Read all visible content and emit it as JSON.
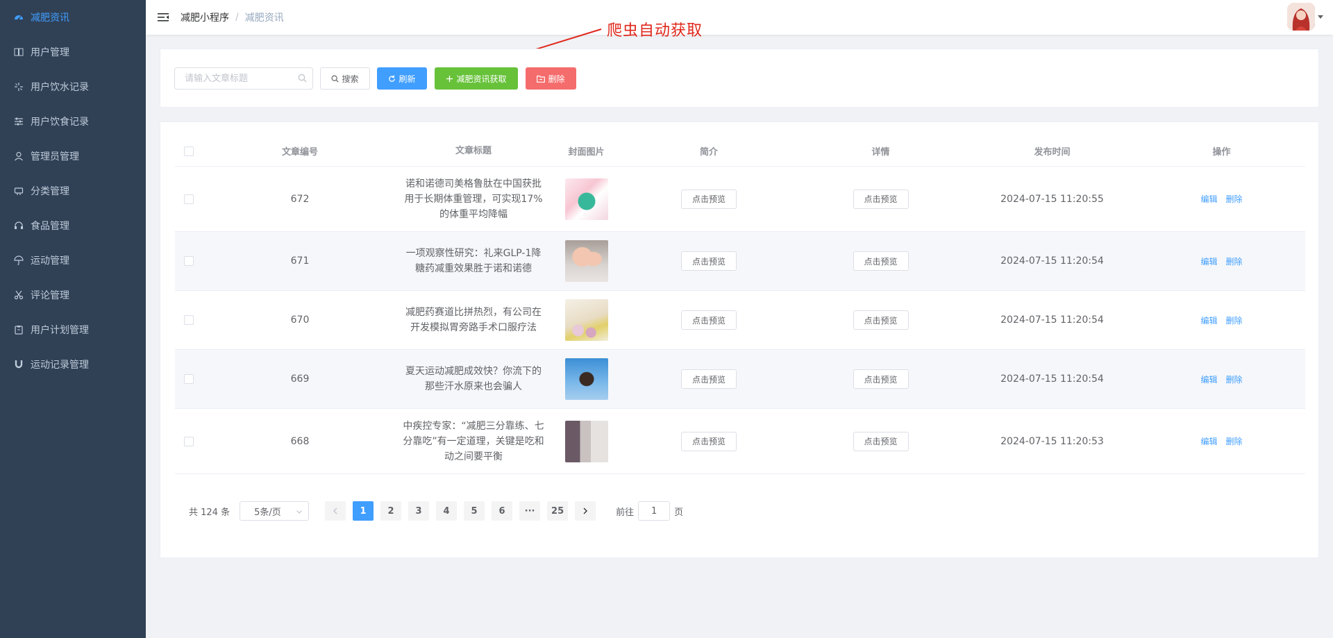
{
  "sidebar": {
    "items": [
      {
        "label": "减肥资讯",
        "icon": "dashboard-icon",
        "active": true
      },
      {
        "label": "用户管理",
        "icon": "book-icon"
      },
      {
        "label": "用户饮水记录",
        "icon": "sparkle-icon"
      },
      {
        "label": "用户饮食记录",
        "icon": "sliders-icon"
      },
      {
        "label": "管理员管理",
        "icon": "user-icon"
      },
      {
        "label": "分类管理",
        "icon": "tag-icon"
      },
      {
        "label": "食品管理",
        "icon": "headset-icon"
      },
      {
        "label": "运动管理",
        "icon": "umbrella-icon"
      },
      {
        "label": "评论管理",
        "icon": "scissors-icon"
      },
      {
        "label": "用户计划管理",
        "icon": "clipboard-icon"
      },
      {
        "label": "运动记录管理",
        "icon": "magnet-icon"
      }
    ]
  },
  "navbar": {
    "breadcrumb": [
      "减肥小程序",
      "减肥资讯"
    ]
  },
  "annotation": "爬虫自动获取",
  "search": {
    "placeholder": "请输入文章标题",
    "value": "",
    "buttons": {
      "search": "搜索",
      "refresh": "刷新",
      "fetch": "减肥资讯获取",
      "delete": "删除"
    }
  },
  "table": {
    "headers": {
      "id": "文章编号",
      "title": "文章标题",
      "cover": "封面图片",
      "intro": "简介",
      "detail": "详情",
      "time": "发布时间",
      "ops": "操作"
    },
    "preview_label": "点击预览",
    "edit_label": "编辑",
    "delete_label": "删除",
    "rows": [
      {
        "id": "672",
        "title": "诺和诺德司美格鲁肽在中国获批用于长期体重管理，可实现17%的体重平均降幅",
        "time": "2024-07-15 11:20:55"
      },
      {
        "id": "671",
        "title": "一项观察性研究：礼来GLP-1降糖药减重效果胜于诺和诺德",
        "time": "2024-07-15 11:20:54"
      },
      {
        "id": "670",
        "title": "减肥药赛道比拼热烈，有公司在开发模拟胃旁路手术口服疗法",
        "time": "2024-07-15 11:20:54"
      },
      {
        "id": "669",
        "title": "夏天运动减肥成效快？你流下的那些汗水原来也会骗人",
        "time": "2024-07-15 11:20:54"
      },
      {
        "id": "668",
        "title": "中疾控专家：“减肥三分靠练、七分靠吃”有一定道理，关键是吃和动之间要平衡",
        "time": "2024-07-15 11:20:53"
      }
    ]
  },
  "pagination": {
    "total": "共 124 条",
    "page_size": "5条/页",
    "pages": [
      "1",
      "2",
      "3",
      "4",
      "5",
      "6",
      "···",
      "25"
    ],
    "current": "1",
    "goto_prefix": "前往",
    "goto_value": "1",
    "goto_suffix": "页"
  },
  "colors": {
    "sidebar_bg": "#304156",
    "primary": "#409eff",
    "success": "#67c23a",
    "danger": "#f56c6c",
    "annotation": "#e0261a"
  }
}
